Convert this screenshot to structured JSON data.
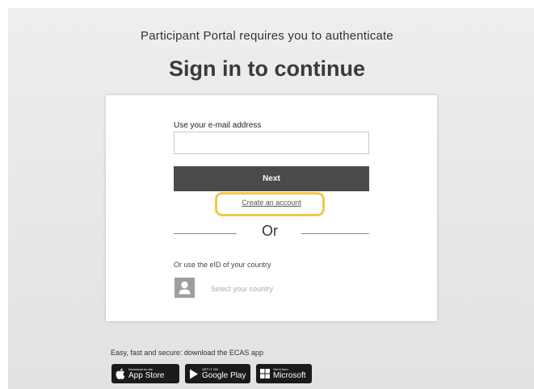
{
  "header": {
    "subtitle": "Participant Portal requires you to authenticate",
    "title": "Sign in to continue"
  },
  "form": {
    "email_label": "Use your e-mail address",
    "email_value": "",
    "email_placeholder": "",
    "next_label": "Next",
    "create_account_label": "Create an account",
    "or_label": "Or",
    "eid_label": "Or use the eID of your country",
    "country_select_label": "Select your country"
  },
  "footer": {
    "app_text": "Easy, fast and secure: download the ECAS app",
    "badges": [
      {
        "small": "Download on the",
        "big": "App Store",
        "icon": "apple-icon"
      },
      {
        "small": "GET IT ON",
        "big": "Google Play",
        "icon": "google-play-icon"
      },
      {
        "small": "Get it from",
        "big": "Microsoft",
        "icon": "microsoft-icon"
      }
    ]
  },
  "colors": {
    "highlight": "#f0c94a",
    "button": "#4a4a4a",
    "background": "#e8e8e8"
  }
}
